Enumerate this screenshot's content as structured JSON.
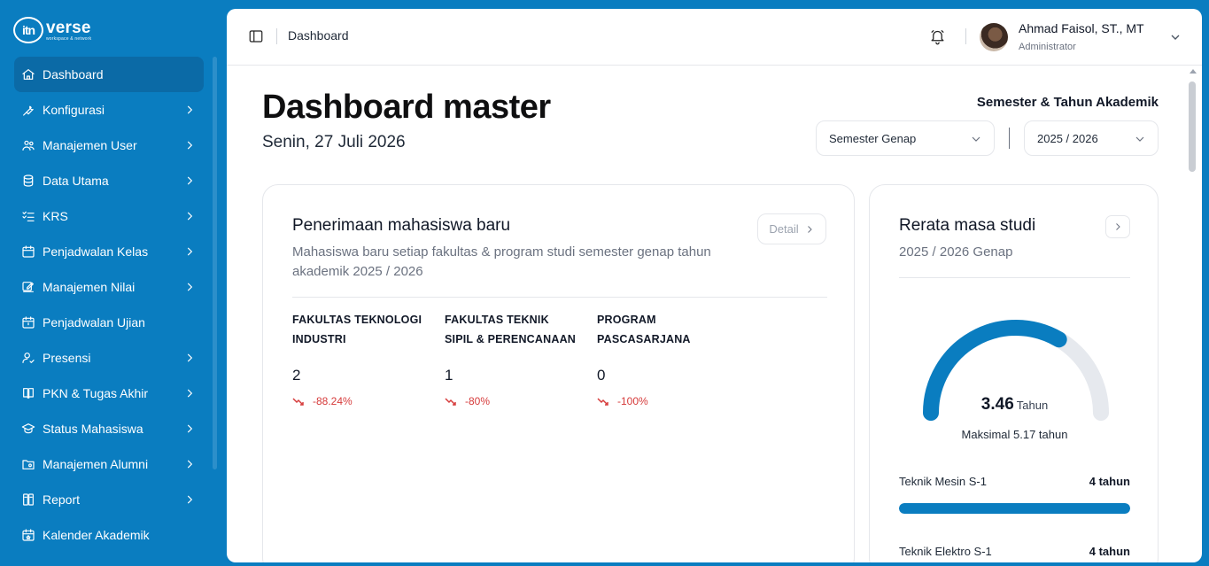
{
  "logo": {
    "mark": "itn",
    "word": "verse",
    "tagline": "workspace & network"
  },
  "sidebar": {
    "items": [
      {
        "label": "Dashboard",
        "icon": "home-icon",
        "active": true,
        "has_children": false
      },
      {
        "label": "Konfigurasi",
        "icon": "wrench-icon",
        "active": false,
        "has_children": true
      },
      {
        "label": "Manajemen User",
        "icon": "users-icon",
        "active": false,
        "has_children": true
      },
      {
        "label": "Data Utama",
        "icon": "database-icon",
        "active": false,
        "has_children": true
      },
      {
        "label": "KRS",
        "icon": "checklist-icon",
        "active": false,
        "has_children": true
      },
      {
        "label": "Penjadwalan Kelas",
        "icon": "calendar-icon",
        "active": false,
        "has_children": true
      },
      {
        "label": "Manajemen Nilai",
        "icon": "edit-icon",
        "active": false,
        "has_children": true
      },
      {
        "label": "Penjadwalan Ujian",
        "icon": "calendar-clock-icon",
        "active": false,
        "has_children": false
      },
      {
        "label": "Presensi",
        "icon": "user-check-icon",
        "active": false,
        "has_children": true
      },
      {
        "label": "PKN & Tugas Akhir",
        "icon": "book-icon",
        "active": false,
        "has_children": true
      },
      {
        "label": "Status Mahasiswa",
        "icon": "graduation-cap-icon",
        "active": false,
        "has_children": true
      },
      {
        "label": "Manajemen Alumni",
        "icon": "folder-user-icon",
        "active": false,
        "has_children": true
      },
      {
        "label": "Report",
        "icon": "report-icon",
        "active": false,
        "has_children": true
      },
      {
        "label": "Kalender Akademik",
        "icon": "calendar-star-icon",
        "active": false,
        "has_children": false
      }
    ]
  },
  "topbar": {
    "breadcrumb": "Dashboard",
    "user_name": "Ahmad Faisol, ST., MT",
    "user_role": "Administrator"
  },
  "header": {
    "title": "Dashboard master",
    "date": "Senin, 27 Juli 2026",
    "academic_label": "Semester & Tahun Akademik",
    "semester_value": "Semester Genap",
    "year_value": "2025 / 2026"
  },
  "new_students": {
    "title": "Penerimaan mahasiswa baru",
    "subtitle": "Mahasiswa baru setiap fakultas & program studi semester genap tahun akademik 2025 / 2026",
    "detail_label": "Detail",
    "faculties": [
      {
        "name": "FAKULTAS TEKNOLOGI INDUSTRI",
        "count": "2",
        "delta": "-88.24%"
      },
      {
        "name": "FAKULTAS TEKNIK SIPIL & PERENCANAAN",
        "count": "1",
        "delta": "-80%"
      },
      {
        "name": "PROGRAM PASCASARJANA",
        "count": "0",
        "delta": "-100%"
      }
    ]
  },
  "study_duration": {
    "title": "Rerata masa studi",
    "subtitle": "2025 / 2026 Genap",
    "average": "3.46",
    "unit": "Tahun",
    "max_label": "Maksimal 5.17 tahun",
    "average_value": 3.46,
    "max_value": 5.17,
    "programs": [
      {
        "name": "Teknik Mesin S-1",
        "value": "4 tahun",
        "fraction": 1.0
      },
      {
        "name": "Teknik Elektro S-1",
        "value": "4 tahun",
        "fraction": 1.0
      }
    ]
  },
  "colors": {
    "brand": "#0a7dc0",
    "negative": "#d63b3b",
    "track": "#e6e9ee"
  }
}
